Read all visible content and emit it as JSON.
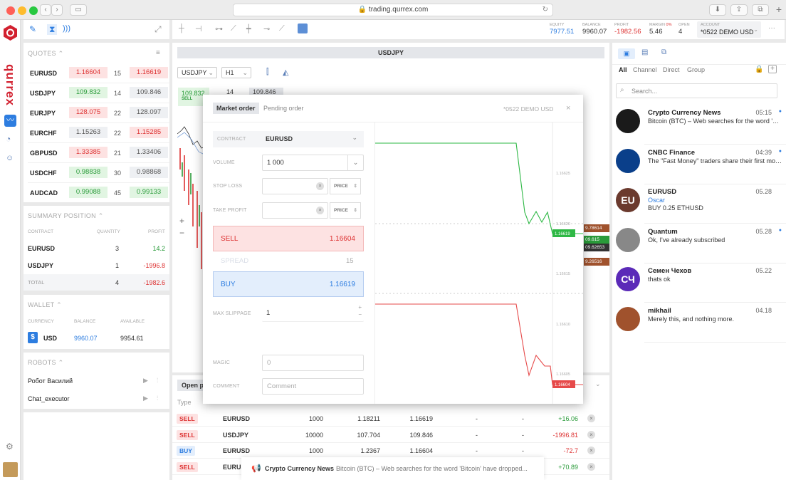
{
  "browser": {
    "url": "trading.qurrex.com"
  },
  "brand": {
    "name": "qurrex",
    "color": "#d2202f"
  },
  "toolbar": {
    "equity_label": "EQUITY",
    "equity": "7977.51",
    "balance_label": "BALANCE",
    "balance": "9960.07",
    "profit_label": "PROFIT",
    "profit": "-1982.56",
    "margin_label": "MARGIN",
    "margin_pct": "0%",
    "margin": "5.46",
    "open_label": "OPEN",
    "open": "4",
    "account_label": "ACCOUNT",
    "account": "*0522 DEMO USD"
  },
  "quotes": {
    "title": "QUOTES",
    "rows": [
      {
        "symbol": "EURUSD",
        "bid": "1.16604",
        "spread": "15",
        "ask": "1.16619",
        "bid_style": "red",
        "ask_style": "red"
      },
      {
        "symbol": "USDJPY",
        "bid": "109.832",
        "spread": "14",
        "ask": "109.846",
        "bid_style": "green",
        "ask_style": "gray"
      },
      {
        "symbol": "EURJPY",
        "bid": "128.075",
        "spread": "22",
        "ask": "128.097",
        "bid_style": "red",
        "ask_style": "gray"
      },
      {
        "symbol": "EURCHF",
        "bid": "1.15263",
        "spread": "22",
        "ask": "1.15285",
        "bid_style": "gray",
        "ask_style": "red"
      },
      {
        "symbol": "GBPUSD",
        "bid": "1.33385",
        "spread": "21",
        "ask": "1.33406",
        "bid_style": "red",
        "ask_style": "gray"
      },
      {
        "symbol": "USDCHF",
        "bid": "0.98838",
        "spread": "30",
        "ask": "0.98868",
        "bid_style": "green",
        "ask_style": "gray"
      },
      {
        "symbol": "AUDCAD",
        "bid": "0.99088",
        "spread": "45",
        "ask": "0.99133",
        "bid_style": "green",
        "ask_style": "green"
      }
    ]
  },
  "summary": {
    "title": "SUMMARY POSITION",
    "col_contract": "CONTRACT",
    "col_quantity": "QUANTITY",
    "col_profit": "PROFIT",
    "rows": [
      {
        "contract": "EURUSD",
        "quantity": "3",
        "profit": "14.2"
      },
      {
        "contract": "USDJPY",
        "quantity": "1",
        "profit": "-1996.8"
      }
    ],
    "total_label": "TOTAL",
    "total_quantity": "4",
    "total_profit": "-1982.6"
  },
  "wallet": {
    "title": "WALLET",
    "col_currency": "CURRENCY",
    "col_balance": "BALANCE",
    "col_available": "AVAILABLE",
    "currency": "USD",
    "balance": "9960.07",
    "available": "9954.61"
  },
  "robots": {
    "title": "ROBOTS",
    "items": [
      "Робот Василий",
      "Chat_executor"
    ]
  },
  "chart": {
    "title": "USDJPY",
    "symbol": "USDJPY",
    "timeframe": "H1",
    "bid": "109.832",
    "bid_action": "SELL",
    "spread": "14",
    "ask": "109.846"
  },
  "modal": {
    "tab_market": "Market order",
    "tab_pending": "Pending order",
    "account": "*0522  DEMO USD",
    "contract_label": "CONTRACT",
    "contract": "EURUSD",
    "volume_label": "VOLUME",
    "volume": "1 000",
    "stop_loss_label": "STOP LOSS",
    "take_profit_label": "TAKE PROFIT",
    "price_btn": "PRICE",
    "sell_label": "SELL",
    "sell_price": "1.16604",
    "spread_label": "SPREAD",
    "spread": "15",
    "buy_label": "BUY",
    "buy_price": "1.16619",
    "slippage_label": "MAX SLIPPAGE",
    "slippage": "1",
    "magic_label": "MAGIC",
    "magic_placeholder": "0",
    "comment_label": "COMMENT",
    "comment_placeholder": "Comment",
    "buy_line_label": "1.16619",
    "sell_line_label": "1.16604",
    "ticks": [
      "1.16625",
      "1.16620",
      "1.16615",
      "1.16610",
      "1.16605"
    ]
  },
  "orders": {
    "tab": "Open p",
    "col_type": "Type",
    "rows": [
      {
        "type": "SELL",
        "contract": "EURUSD",
        "amount": "1000",
        "open": "1.18211",
        "current": "1.16619",
        "sl": "-",
        "tp": "-",
        "profit": "+16.06"
      },
      {
        "type": "SELL",
        "contract": "USDJPY",
        "amount": "10000",
        "open": "107.704",
        "current": "109.846",
        "sl": "-",
        "tp": "-",
        "profit": "-1996.81"
      },
      {
        "type": "BUY",
        "contract": "EURUSD",
        "amount": "1000",
        "open": "1.2367",
        "current": "1.16604",
        "sl": "-",
        "tp": "-",
        "profit": "-72.7"
      },
      {
        "type": "SELL",
        "contract": "EURUS",
        "amount": "",
        "open": "",
        "current": "",
        "sl": "",
        "tp": "",
        "profit": "+70.89"
      }
    ]
  },
  "right_labels": [
    "9.78614",
    "09.615",
    "09.62653",
    "9.26516"
  ],
  "notification": {
    "title": "Crypto Currency News",
    "text": "Bitcoin (BTC) – Web searches for the word 'Bitcoin' have dropped..."
  },
  "chat": {
    "tabs": [
      "All",
      "Channel",
      "Direct",
      "Group"
    ],
    "search_placeholder": "Search...",
    "items": [
      {
        "name": "Crypto Currency News",
        "time": "05:15",
        "msg": "Bitcoin (BTC) – Web searches for the word 'Bitcoin' have dropped",
        "sub": "",
        "initials": "",
        "color": "#1a1a1a"
      },
      {
        "name": "CNBC Finance",
        "time": "04:39",
        "msg": "The \"Fast Money\" traders share their first moves",
        "sub": "",
        "initials": "",
        "color": "#0a3f8a"
      },
      {
        "name": "EURUSD",
        "time": "05.28",
        "msg": "BUY 0.25 ETHUSD",
        "sub": "Oscar",
        "initials": "EU",
        "color": "#6b3a2e"
      },
      {
        "name": "Quantum",
        "time": "05.28",
        "msg": "Ok, I've already subscribed",
        "sub": "",
        "initials": "",
        "color": "#888888"
      },
      {
        "name": "Семен Чехов",
        "time": "05.22",
        "msg": "thats ok",
        "sub": "",
        "initials": "СЧ",
        "color": "#5b2ab8"
      },
      {
        "name": "mikhail",
        "time": "04.18",
        "msg": "Merely this, and nothing more.",
        "sub": "",
        "initials": "",
        "color": "#a0522d"
      }
    ]
  }
}
